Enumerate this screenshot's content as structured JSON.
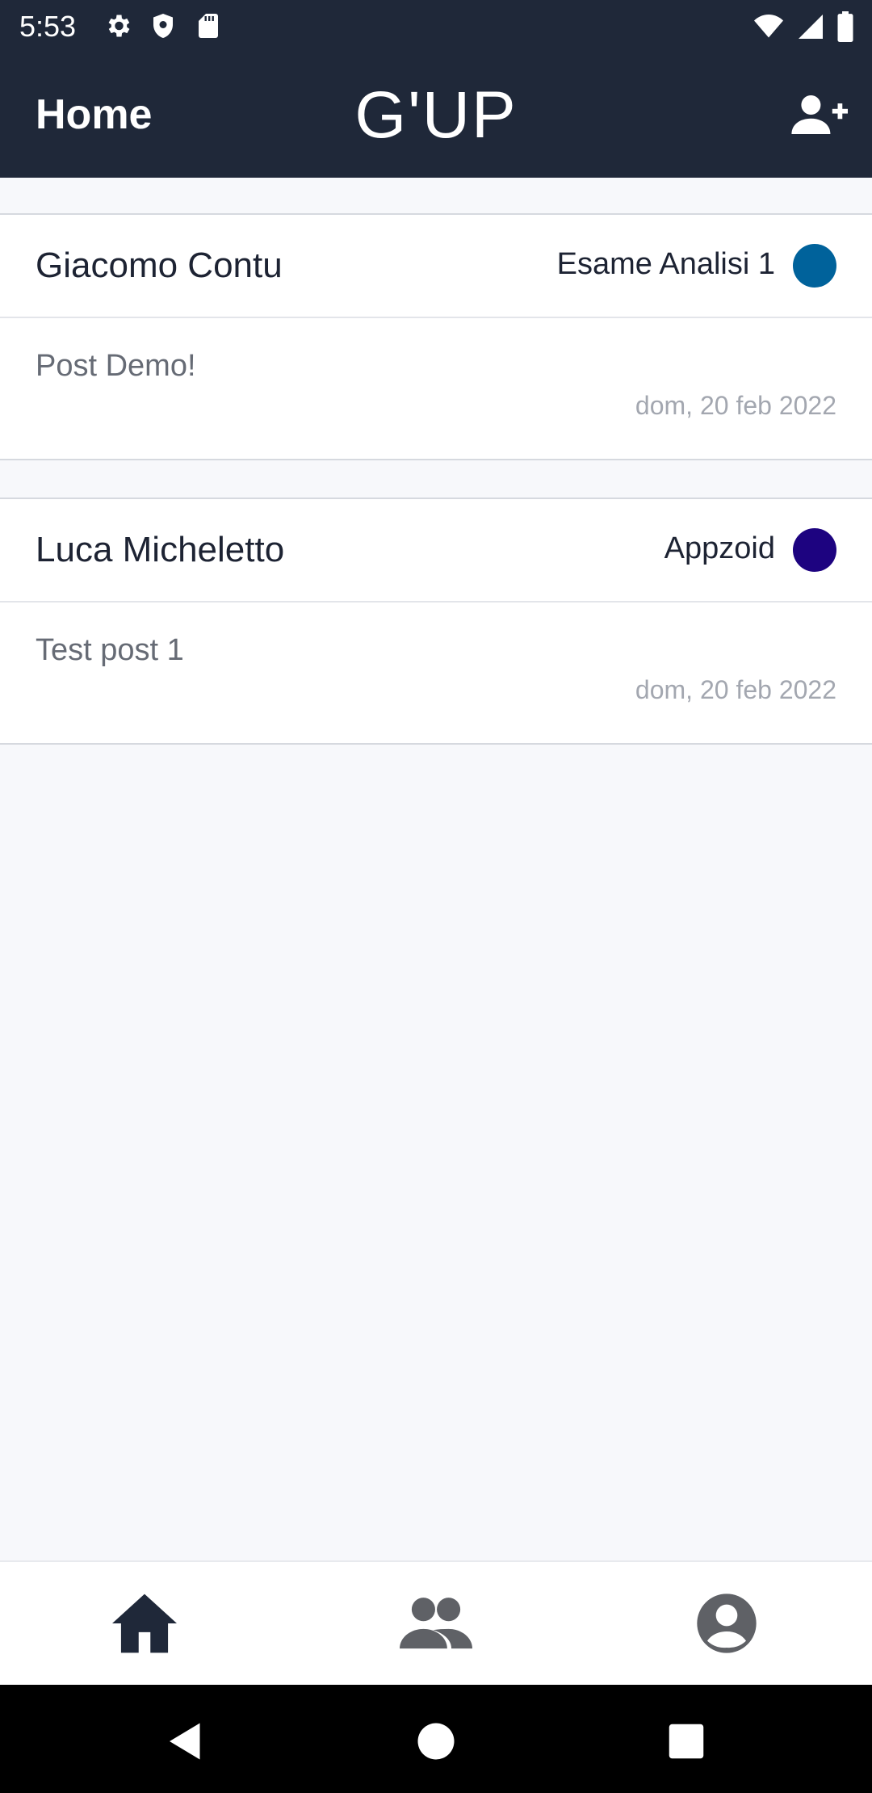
{
  "status_bar": {
    "time": "5:53",
    "icons_left": [
      "settings-icon",
      "shield-icon",
      "sd-card-icon"
    ],
    "icons_right": [
      "wifi-icon",
      "signal-icon",
      "battery-icon"
    ]
  },
  "app_bar": {
    "title": "Home",
    "brand": "G'UP",
    "action_icon": "add-person-icon",
    "background": "#1f2839"
  },
  "posts": [
    {
      "author": "Giacomo Contu",
      "group": "Esame Analisi 1",
      "group_color": "#00629b",
      "text": "Post Demo!",
      "date": "dom, 20 feb 2022"
    },
    {
      "author": "Luca Micheletto",
      "group": "Appzoid",
      "group_color": "#1d0380",
      "text": "Test post 1",
      "date": "dom, 20 feb 2022"
    }
  ],
  "bottom_nav": {
    "items": [
      {
        "icon": "home-icon",
        "active": true
      },
      {
        "icon": "people-icon",
        "active": false
      },
      {
        "icon": "account-circle-icon",
        "active": false
      }
    ],
    "active_color": "#1f2839",
    "inactive_color": "#5f6166"
  },
  "system_nav": [
    "back-icon",
    "home-circle-icon",
    "recents-icon"
  ]
}
